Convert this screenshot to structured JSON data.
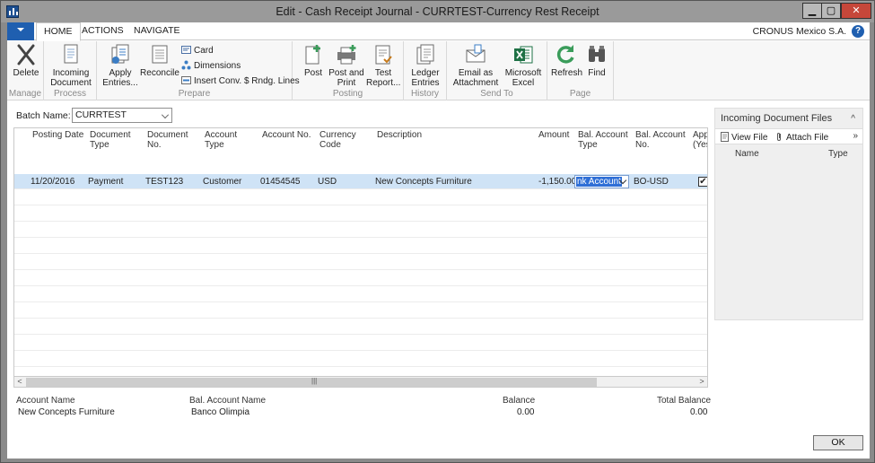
{
  "window": {
    "title": "Edit - Cash Receipt Journal - CURRTEST-Currency Rest Receipt",
    "minimize": "▁",
    "maximize": "▢",
    "close": "✕"
  },
  "tabs": [
    {
      "label": "HOME",
      "active": true
    },
    {
      "label": "ACTIONS",
      "active": false
    },
    {
      "label": "NAVIGATE",
      "active": false
    }
  ],
  "company": "CRONUS Mexico S.A.",
  "help_label": "?",
  "ribbon": {
    "groups": {
      "manage": "Manage",
      "process": "Process",
      "prepare": "Prepare",
      "posting": "Posting",
      "history": "History",
      "send_to": "Send To",
      "page": "Page"
    },
    "buttons": {
      "delete": "Delete",
      "incoming_document_1": "Incoming",
      "incoming_document_2": "Document",
      "apply_entries_1": "Apply",
      "apply_entries_2": "Entries...",
      "reconcile": "Reconcile",
      "card": "Card",
      "dimensions": "Dimensions",
      "insert_conv": "Insert Conv. $ Rndg. Lines",
      "post": "Post",
      "post_and_print_1": "Post and",
      "post_and_print_2": "Print",
      "test_report_1": "Test",
      "test_report_2": "Report...",
      "ledger_entries_1": "Ledger",
      "ledger_entries_2": "Entries",
      "email_1": "Email as",
      "email_2": "Attachment",
      "excel_1": "Microsoft",
      "excel_2": "Excel",
      "refresh": "Refresh",
      "find": "Find"
    },
    "colors": {
      "delete_x": "#444444",
      "excel_green": "#1e7145",
      "refresh_green": "#3a9c5a"
    }
  },
  "batch": {
    "label": "Batch Name:",
    "value": "CURRTEST"
  },
  "grid": {
    "columns": {
      "posting_date": "Posting Date",
      "document_type_1": "Document",
      "document_type_2": "Type",
      "document_no_1": "Document",
      "document_no_2": "No.",
      "account_type_1": "Account",
      "account_type_2": "Type",
      "account_no": "Account No.",
      "currency_code_1": "Currency",
      "currency_code_2": "Code",
      "description": "Description",
      "amount": "Amount",
      "bal_account_type_1": "Bal. Account",
      "bal_account_type_2": "Type",
      "bal_account_no_1": "Bal. Account",
      "bal_account_no_2": "No.",
      "applied_1": "App",
      "applied_2": "(Yes"
    },
    "rows": [
      {
        "posting_date": "11/20/2016",
        "document_type": "Payment",
        "document_no": "TEST123",
        "account_type": "Customer",
        "account_no": "01454545",
        "currency_code": "USD",
        "description": "New Concepts Furniture",
        "amount": "-1,150.00",
        "bal_account_type": "nk Account",
        "bal_account_no": "BO-USD",
        "applied": "✔"
      }
    ],
    "scroll_grip": "|||",
    "scroll_left": "<",
    "scroll_right": ">"
  },
  "footer": {
    "account_name_label": "Account Name",
    "account_name_value": "New Concepts Furniture",
    "bal_account_name_label": "Bal. Account Name",
    "bal_account_name_value": "Banco Olimpia",
    "balance_label": "Balance",
    "balance_value": "0.00",
    "total_balance_label": "Total Balance",
    "total_balance_value": "0.00"
  },
  "factbox": {
    "title": "Incoming Document Files",
    "collapse": "^",
    "view_file": "View File",
    "attach_file": "Attach File",
    "more": "»",
    "col_name": "Name",
    "col_type": "Type"
  },
  "ok_label": "OK"
}
